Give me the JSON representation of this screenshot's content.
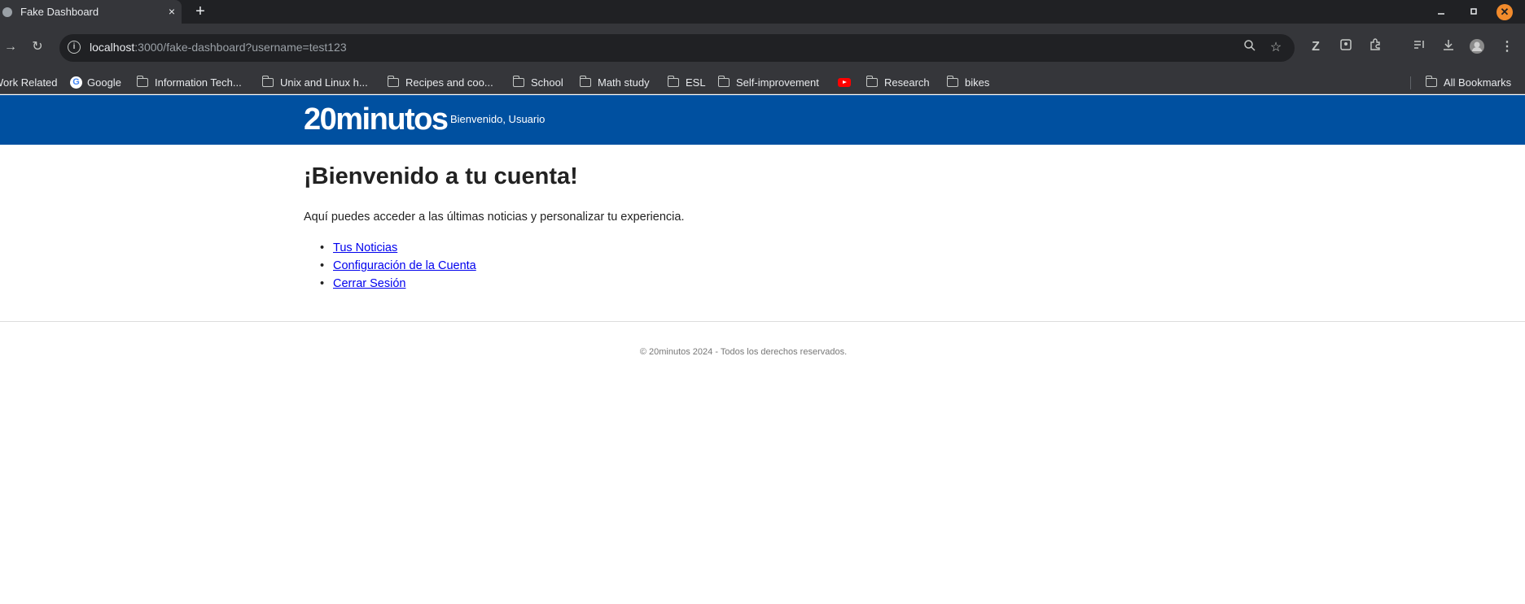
{
  "browser": {
    "tab_title": "Fake Dashboard",
    "tab_close": "×",
    "new_tab": "+",
    "url_host": "localhost",
    "url_path": ":3000/fake-dashboard?username=test123",
    "bookmarks": [
      {
        "label": "Work Related",
        "icon": "folder-icon"
      },
      {
        "label": "Google",
        "icon": "google-icon"
      },
      {
        "label": "Information Tech...",
        "icon": "folder-icon"
      },
      {
        "label": "Unix and Linux h...",
        "icon": "folder-icon"
      },
      {
        "label": "Recipes and coo...",
        "icon": "folder-icon"
      },
      {
        "label": "School",
        "icon": "folder-icon"
      },
      {
        "label": "Math study",
        "icon": "folder-icon"
      },
      {
        "label": "ESL",
        "icon": "folder-icon"
      },
      {
        "label": "Self-improvement",
        "icon": "folder-icon"
      },
      {
        "label": "",
        "icon": "youtube-icon"
      },
      {
        "label": "Research",
        "icon": "folder-icon"
      },
      {
        "label": "bikes",
        "icon": "folder-icon"
      }
    ],
    "all_bookmarks": "All Bookmarks"
  },
  "site": {
    "logo": "20minutos",
    "welcome_user": "Bienvenido, Usuario",
    "heading": "¡Bienvenido a tu cuenta!",
    "intro": "Aquí puedes acceder a las últimas noticias y personalizar tu experiencia.",
    "links": [
      "Tus Noticias",
      "Configuración de la Cuenta",
      "Cerrar Sesión"
    ],
    "footer": "© 20minutos 2024 - Todos los derechos reservados."
  },
  "colors": {
    "header_bg": "#0050a0",
    "link": "#0000ee",
    "chrome_dark": "#35363a"
  }
}
